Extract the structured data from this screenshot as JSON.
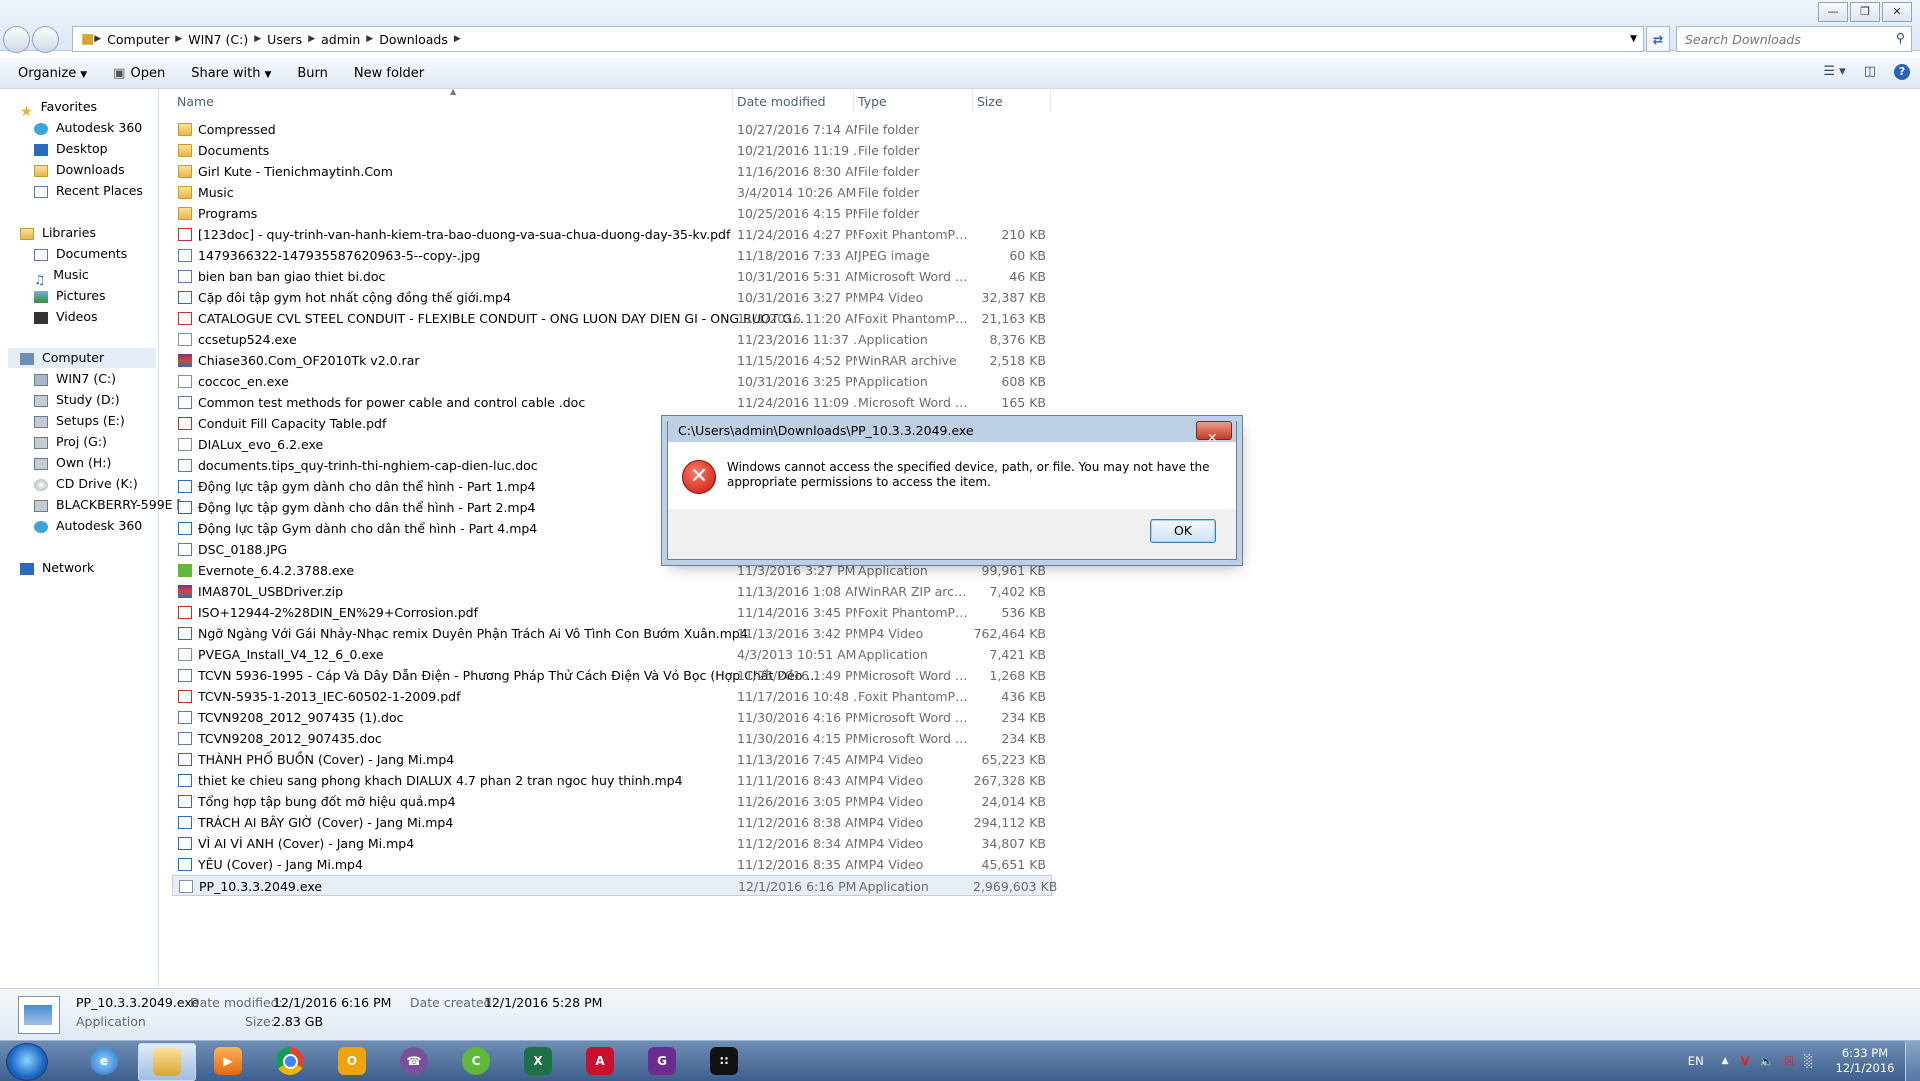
{
  "address": {
    "path": [
      "Computer",
      "WIN7 (C:)",
      "Users",
      "admin",
      "Downloads"
    ],
    "search_placeholder": "Search Downloads"
  },
  "toolbar": {
    "organize": "Organize",
    "open": "Open",
    "share_with": "Share with",
    "burn": "Burn",
    "new_folder": "New folder"
  },
  "nav": {
    "favorites": "Favorites",
    "fav_items": [
      "Autodesk 360",
      "Desktop",
      "Downloads",
      "Recent Places"
    ],
    "libraries": "Libraries",
    "lib_items": [
      "Documents",
      "Music",
      "Pictures",
      "Videos"
    ],
    "computer": "Computer",
    "comp_items": [
      "WIN7 (C:)",
      "Study (D:)",
      "Setups (E:)",
      "Proj (G:)",
      "Own (H:)",
      "CD Drive (K:)",
      "BLACKBERRY-599E [",
      "Autodesk 360"
    ],
    "network": "Network"
  },
  "columns": {
    "name": "Name",
    "date": "Date modified",
    "type": "Type",
    "size": "Size"
  },
  "files": [
    {
      "name": "Compressed",
      "date": "10/27/2016 7:14 AM",
      "type": "File folder",
      "size": "",
      "icon": "folder"
    },
    {
      "name": "Documents",
      "date": "10/21/2016 11:19 ...",
      "type": "File folder",
      "size": "",
      "icon": "folder"
    },
    {
      "name": "Girl Kute - Tienichmaytinh.Com",
      "date": "11/16/2016 8:30 AM",
      "type": "File folder",
      "size": "",
      "icon": "folder"
    },
    {
      "name": "Music",
      "date": "3/4/2014 10:26 AM",
      "type": "File folder",
      "size": "",
      "icon": "folder"
    },
    {
      "name": "Programs",
      "date": "10/25/2016 4:15 PM",
      "type": "File folder",
      "size": "",
      "icon": "folder"
    },
    {
      "name": "[123doc] - quy-trinh-van-hanh-kiem-tra-bao-duong-va-sua-chua-duong-day-35-kv.pdf",
      "date": "11/24/2016 4:27 PM",
      "type": "Foxit PhantomPD...",
      "size": "210 KB",
      "icon": "pdf"
    },
    {
      "name": "1479366322-147935587620963-5--copy-.jpg",
      "date": "11/18/2016 7:33 AM",
      "type": "JPEG image",
      "size": "60 KB",
      "icon": "image"
    },
    {
      "name": "bien ban ban giao thiet bi.doc",
      "date": "10/31/2016 5:31 AM",
      "type": "Microsoft Word 9...",
      "size": "46 KB",
      "icon": "word"
    },
    {
      "name": "Cặp đôi tập gym hot nhất cộng đồng thế giới.mp4",
      "date": "10/31/2016 3:27 PM",
      "type": "MP4 Video",
      "size": "32,387 KB",
      "icon": "video"
    },
    {
      "name": "CATALOGUE CVL STEEL CONDUIT - FLEXIBLE CONDUIT - ONG LUON DAY DIEN GI - ONG RUOT G...",
      "date": "11/1/2016 11:20 AM",
      "type": "Foxit PhantomPD...",
      "size": "21,163 KB",
      "icon": "pdf"
    },
    {
      "name": "ccsetup524.exe",
      "date": "11/23/2016 11:37 ...",
      "type": "Application",
      "size": "8,376 KB",
      "icon": "exe"
    },
    {
      "name": "Chiase360.Com_OF2010Tk v2.0.rar",
      "date": "11/15/2016 4:52 PM",
      "type": "WinRAR archive",
      "size": "2,518 KB",
      "icon": "rar"
    },
    {
      "name": "coccoc_en.exe",
      "date": "10/31/2016 3:25 PM",
      "type": "Application",
      "size": "608 KB",
      "icon": "exe"
    },
    {
      "name": "Common test methods for power cable and control cable .doc",
      "date": "11/24/2016 11:09 ...",
      "type": "Microsoft Word 9...",
      "size": "165 KB",
      "icon": "word"
    },
    {
      "name": "Conduit Fill Capacity Table.pdf",
      "date": "",
      "type": "",
      "size": "",
      "icon": "pdf"
    },
    {
      "name": "DIALux_evo_6.2.exe",
      "date": "",
      "type": "",
      "size": "",
      "icon": "exe"
    },
    {
      "name": "documents.tips_quy-trinh-thi-nghiem-cap-dien-luc.doc",
      "date": "",
      "type": "",
      "size": "",
      "icon": "word"
    },
    {
      "name": "Động lực tập gym dành cho dân thể hình - Part 1.mp4",
      "date": "",
      "type": "",
      "size": "",
      "icon": "video"
    },
    {
      "name": "Động lực tập gym dành cho dân thể hình - Part 2.mp4",
      "date": "",
      "type": "",
      "size": "",
      "icon": "video"
    },
    {
      "name": "Động lực tập Gym dành cho dân thể hình - Part 4.mp4",
      "date": "",
      "type": "",
      "size": "",
      "icon": "video"
    },
    {
      "name": "DSC_0188.JPG",
      "date": "",
      "type": "",
      "size": "",
      "icon": "image"
    },
    {
      "name": "Evernote_6.4.2.3788.exe",
      "date": "11/3/2016 3:27 PM",
      "type": "Application",
      "size": "99,961 KB",
      "icon": "evernote"
    },
    {
      "name": "IMA870L_USBDriver.zip",
      "date": "11/13/2016 1:08 AM",
      "type": "WinRAR ZIP archive",
      "size": "7,402 KB",
      "icon": "rar"
    },
    {
      "name": "ISO+12944-2%28DIN_EN%29+Corrosion.pdf",
      "date": "11/14/2016 3:45 PM",
      "type": "Foxit PhantomPD...",
      "size": "536 KB",
      "icon": "pdf"
    },
    {
      "name": "Ngỡ Ngàng Với Gái Nhảy-Nhạc remix Duyên Phận Trách Ai Vô Tình Con Bướm Xuân.mp4",
      "date": "11/13/2016 3:42 PM",
      "type": "MP4 Video",
      "size": "762,464 KB",
      "icon": "video"
    },
    {
      "name": "PVEGA_Install_V4_12_6_0.exe",
      "date": "4/3/2013 10:51 AM",
      "type": "Application",
      "size": "7,421 KB",
      "icon": "exe"
    },
    {
      "name": "TCVN 5936-1995 - Cáp Và Dây Dẫn Điện - Phương Pháp Thử Cách Điện Và Vỏ Bọc (Hợp Chất Dẻo ...",
      "date": "11/25/2016 1:49 PM",
      "type": "Microsoft Word 9...",
      "size": "1,268 KB",
      "icon": "word"
    },
    {
      "name": "TCVN-5935-1-2013_IEC-60502-1-2009.pdf",
      "date": "11/17/2016 10:48 ...",
      "type": "Foxit PhantomPD...",
      "size": "436 KB",
      "icon": "pdf"
    },
    {
      "name": "TCVN9208_2012_907435 (1).doc",
      "date": "11/30/2016 4:16 PM",
      "type": "Microsoft Word 9...",
      "size": "234 KB",
      "icon": "word"
    },
    {
      "name": "TCVN9208_2012_907435.doc",
      "date": "11/30/2016 4:15 PM",
      "type": "Microsoft Word 9...",
      "size": "234 KB",
      "icon": "word"
    },
    {
      "name": "THÀNH PHỐ BUỒN (Cover) - Jang Mi.mp4",
      "date": "11/13/2016 7:45 AM",
      "type": "MP4 Video",
      "size": "65,223 KB",
      "icon": "video"
    },
    {
      "name": "thiet ke chieu sang phong khach DIALUX 4.7 phan 2 tran ngoc huy thinh.mp4",
      "date": "11/11/2016 8:43 AM",
      "type": "MP4 Video",
      "size": "267,328 KB",
      "icon": "video"
    },
    {
      "name": "Tổng hợp tập bung đốt mỡ hiệu quả.mp4",
      "date": "11/26/2016 3:05 PM",
      "type": "MP4 Video",
      "size": "24,014 KB",
      "icon": "video"
    },
    {
      "name": "TRÁCH AI BÂY GIỜ (Cover) - Jang Mi.mp4",
      "date": "11/12/2016 8:38 AM",
      "type": "MP4 Video",
      "size": "294,112 KB",
      "icon": "video"
    },
    {
      "name": "VÌ AI VÌ ANH (Cover) - Jang Mi.mp4",
      "date": "11/12/2016 8:34 AM",
      "type": "MP4 Video",
      "size": "34,807 KB",
      "icon": "video"
    },
    {
      "name": "YÊU (Cover) - Jang Mi.mp4",
      "date": "11/12/2016 8:35 AM",
      "type": "MP4 Video",
      "size": "45,651 KB",
      "icon": "video"
    },
    {
      "name": "PP_10.3.3.2049.exe",
      "date": "12/1/2016 6:16 PM",
      "type": "Application",
      "size": "2,969,603 KB",
      "icon": "exe",
      "selected": true
    }
  ],
  "details": {
    "filename": "PP_10.3.3.2049.exe",
    "type": "Application",
    "modified_label": "Date modified:",
    "modified_value": "12/1/2016 6:16 PM",
    "created_label": "Date created:",
    "created_value": "12/1/2016 5:28 PM",
    "size_label": "Size:",
    "size_value": "2.83 GB"
  },
  "dialog": {
    "title": "C:\\Users\\admin\\Downloads\\PP_10.3.3.2049.exe",
    "message": "Windows cannot access the specified device, path, or file.  You may not have the appropriate permissions to access the item.",
    "ok": "OK"
  },
  "taskbar": {
    "apps": [
      "explorer-ie",
      "file-explorer",
      "media-player",
      "chrome",
      "outlook",
      "viber",
      "coccoc",
      "excel",
      "autocad",
      "pdf",
      "blackberry"
    ],
    "language": "EN",
    "time": "6:33 PM",
    "date": "12/1/2016"
  },
  "colors": {
    "taskbar": "#4e6e9a",
    "dialog_frame": "#bdd0e6",
    "error_red": "#c4140a"
  }
}
